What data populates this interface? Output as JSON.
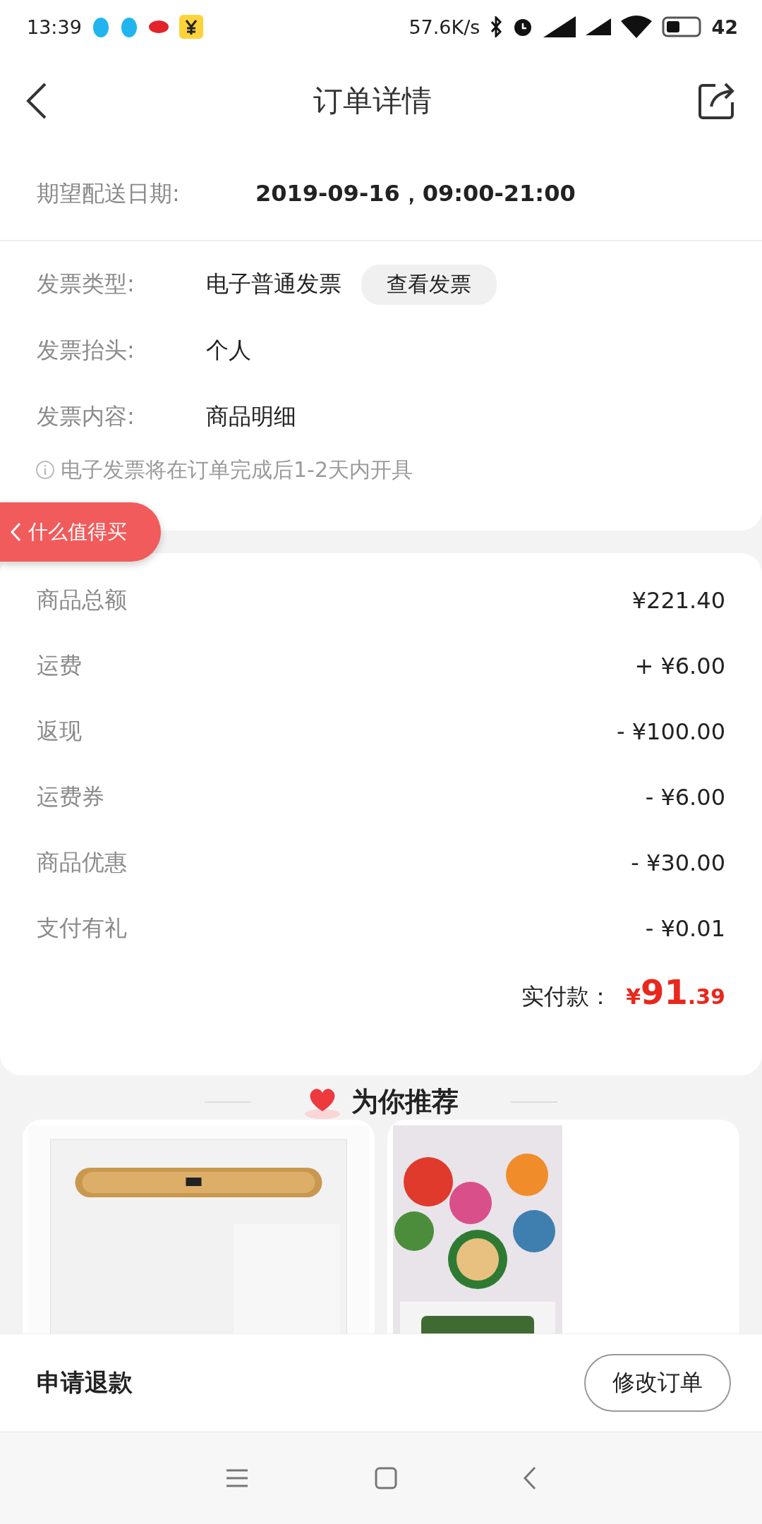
{
  "status_bar": {
    "time": "13:39",
    "speed": "57.6K/s",
    "battery": "42"
  },
  "header": {
    "title": "订单详情"
  },
  "delivery": {
    "label": "期望配送日期:",
    "value": "2019-09-16，09:00-21:00"
  },
  "invoice": {
    "rows": [
      {
        "label": "发票类型:",
        "value": "电子普通发票",
        "action": "查看发票"
      },
      {
        "label": "发票抬头:",
        "value": "个人"
      },
      {
        "label": "发票内容:",
        "value": "商品明细"
      }
    ],
    "note": "电子发票将在订单完成后1-2天内开具"
  },
  "floating_tab": {
    "label": "什么值得买"
  },
  "payment": {
    "rows": [
      {
        "label": "商品总额",
        "value": "¥221.40"
      },
      {
        "label": "运费",
        "value": "+ ¥6.00"
      },
      {
        "label": "返现",
        "value": "- ¥100.00"
      },
      {
        "label": "运费券",
        "value": "- ¥6.00"
      },
      {
        "label": "商品优惠",
        "value": "- ¥30.00"
      },
      {
        "label": "支付有礼",
        "value": "- ¥0.01"
      }
    ],
    "total_label": "实付款：",
    "total": {
      "symbol": "¥",
      "integer": "91",
      "fraction": ".39"
    }
  },
  "recommend": {
    "title": "为你推荐"
  },
  "bottom_bar": {
    "refund": "申请退款",
    "modify": "修改订单"
  }
}
